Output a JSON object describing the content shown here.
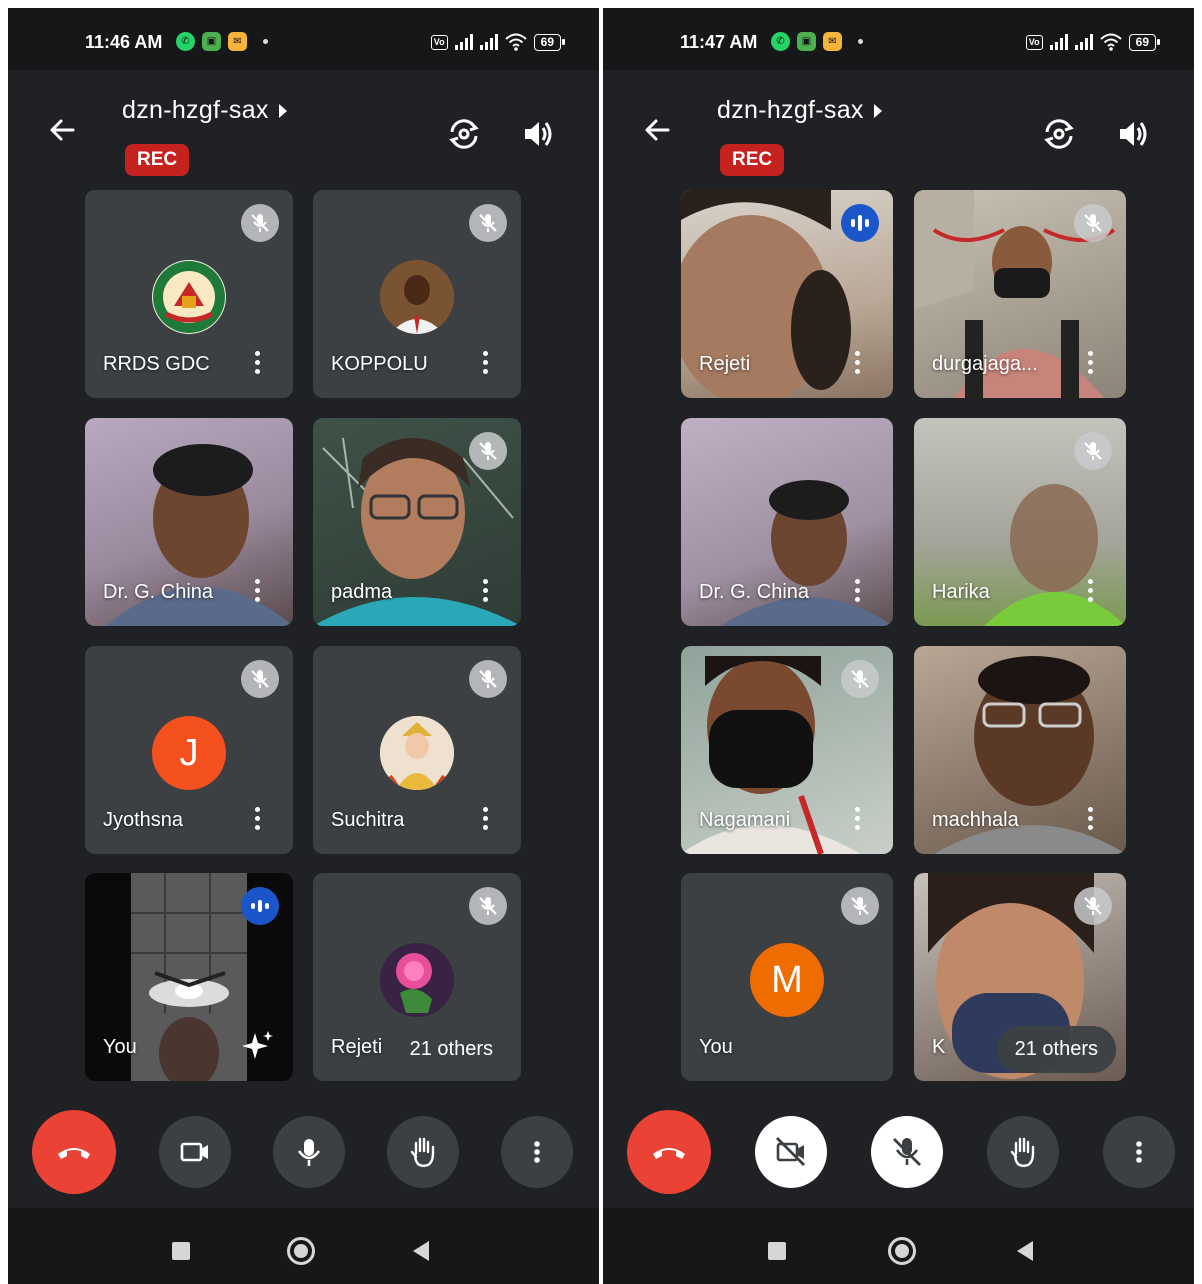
{
  "colors": {
    "background": "#202124",
    "tile": "#3c4043",
    "rec": "#c5221f",
    "hangup": "#ea4335",
    "speaking": "#1a56c9"
  },
  "screens": [
    {
      "status_time": "11:46 AM",
      "battery": "69",
      "meeting_code": "dzn-hzgf-sax",
      "rec_label": "REC",
      "tiles": [
        {
          "name": "RRDS GDC",
          "muted": true,
          "avatar": "college-logo"
        },
        {
          "name": "KOPPOLU",
          "muted": true,
          "avatar": "person-photo"
        },
        {
          "name": "Dr. G. China",
          "muted": false,
          "video": true
        },
        {
          "name": "padma",
          "muted": true,
          "video": true
        },
        {
          "name": "Jyothsna",
          "muted": true,
          "avatar_letter": "J",
          "avatar_color": "#f4511e"
        },
        {
          "name": "Suchitra",
          "muted": true,
          "avatar": "child-photo"
        },
        {
          "name": "You",
          "speaking": true,
          "video": true
        },
        {
          "name": "Rejeti",
          "muted": true,
          "avatar": "rose-photo",
          "others_label": "21 others"
        }
      ],
      "controls": [
        "end-call",
        "camera-on",
        "mic-on",
        "raise-hand",
        "more"
      ]
    },
    {
      "status_time": "11:47 AM",
      "battery": "69",
      "meeting_code": "dzn-hzgf-sax",
      "rec_label": "REC",
      "tiles": [
        {
          "name": "Rejeti",
          "speaking": true,
          "video": true
        },
        {
          "name": "durgajaga...",
          "muted": true,
          "video": true
        },
        {
          "name": "Dr. G. China",
          "muted": false,
          "video": true
        },
        {
          "name": "Harika",
          "muted": true,
          "video": true
        },
        {
          "name": "Nagamani",
          "muted": true,
          "video": true
        },
        {
          "name": "machhala",
          "muted": false,
          "video": true
        },
        {
          "name": "You",
          "muted": true,
          "avatar_letter": "M",
          "avatar_color": "#ef6c00"
        },
        {
          "name": "K",
          "muted": true,
          "video": true,
          "others_label": "21 others"
        }
      ],
      "controls": [
        "end-call",
        "camera-off",
        "mic-off",
        "raise-hand",
        "more"
      ]
    }
  ]
}
